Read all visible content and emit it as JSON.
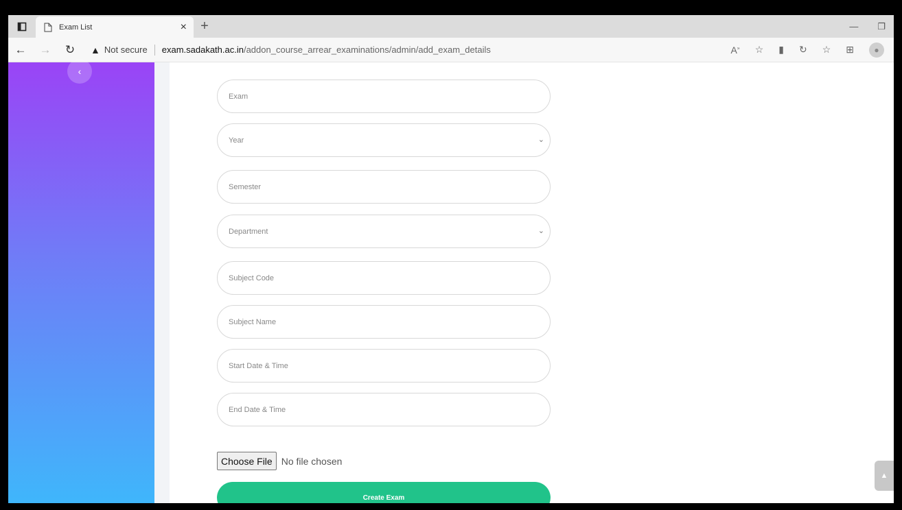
{
  "browser": {
    "tab_title": "Exam List",
    "tab_close": "×",
    "new_tab": "+",
    "minimize": "—",
    "restore": "❐",
    "back": "←",
    "forward": "→",
    "reload": "↻",
    "security_warning_icon": "▲",
    "security_label": "Not secure",
    "url_host": "exam.sadakath.ac.in",
    "url_path": "/addon_course_arrear_examinations/admin/add_exam_details",
    "icons": [
      "read-aloud-icon",
      "add-favorite-icon",
      "extension-icon",
      "refresh-extension-icon",
      "favorites-icon",
      "collections-icon",
      "profile-icon"
    ]
  },
  "sidebar": {
    "collapse_glyph": "‹",
    "gradient_colors": [
      "#9a44f6",
      "#6f7df7",
      "#3fb6fb"
    ]
  },
  "form": {
    "exam_placeholder": "Exam",
    "year_placeholder": "Year",
    "semester_placeholder": "Semester",
    "department_placeholder": "Department",
    "subject_code_placeholder": "Subject Code",
    "subject_name_placeholder": "Subject Name",
    "start_placeholder": "Start Date & Time",
    "end_placeholder": "End Date & Time",
    "file_button": "Choose File",
    "file_status": "No file chosen",
    "submit_label": "Create Exam",
    "accent_color": "#21c38a"
  },
  "scroll_top_glyph": "▲"
}
